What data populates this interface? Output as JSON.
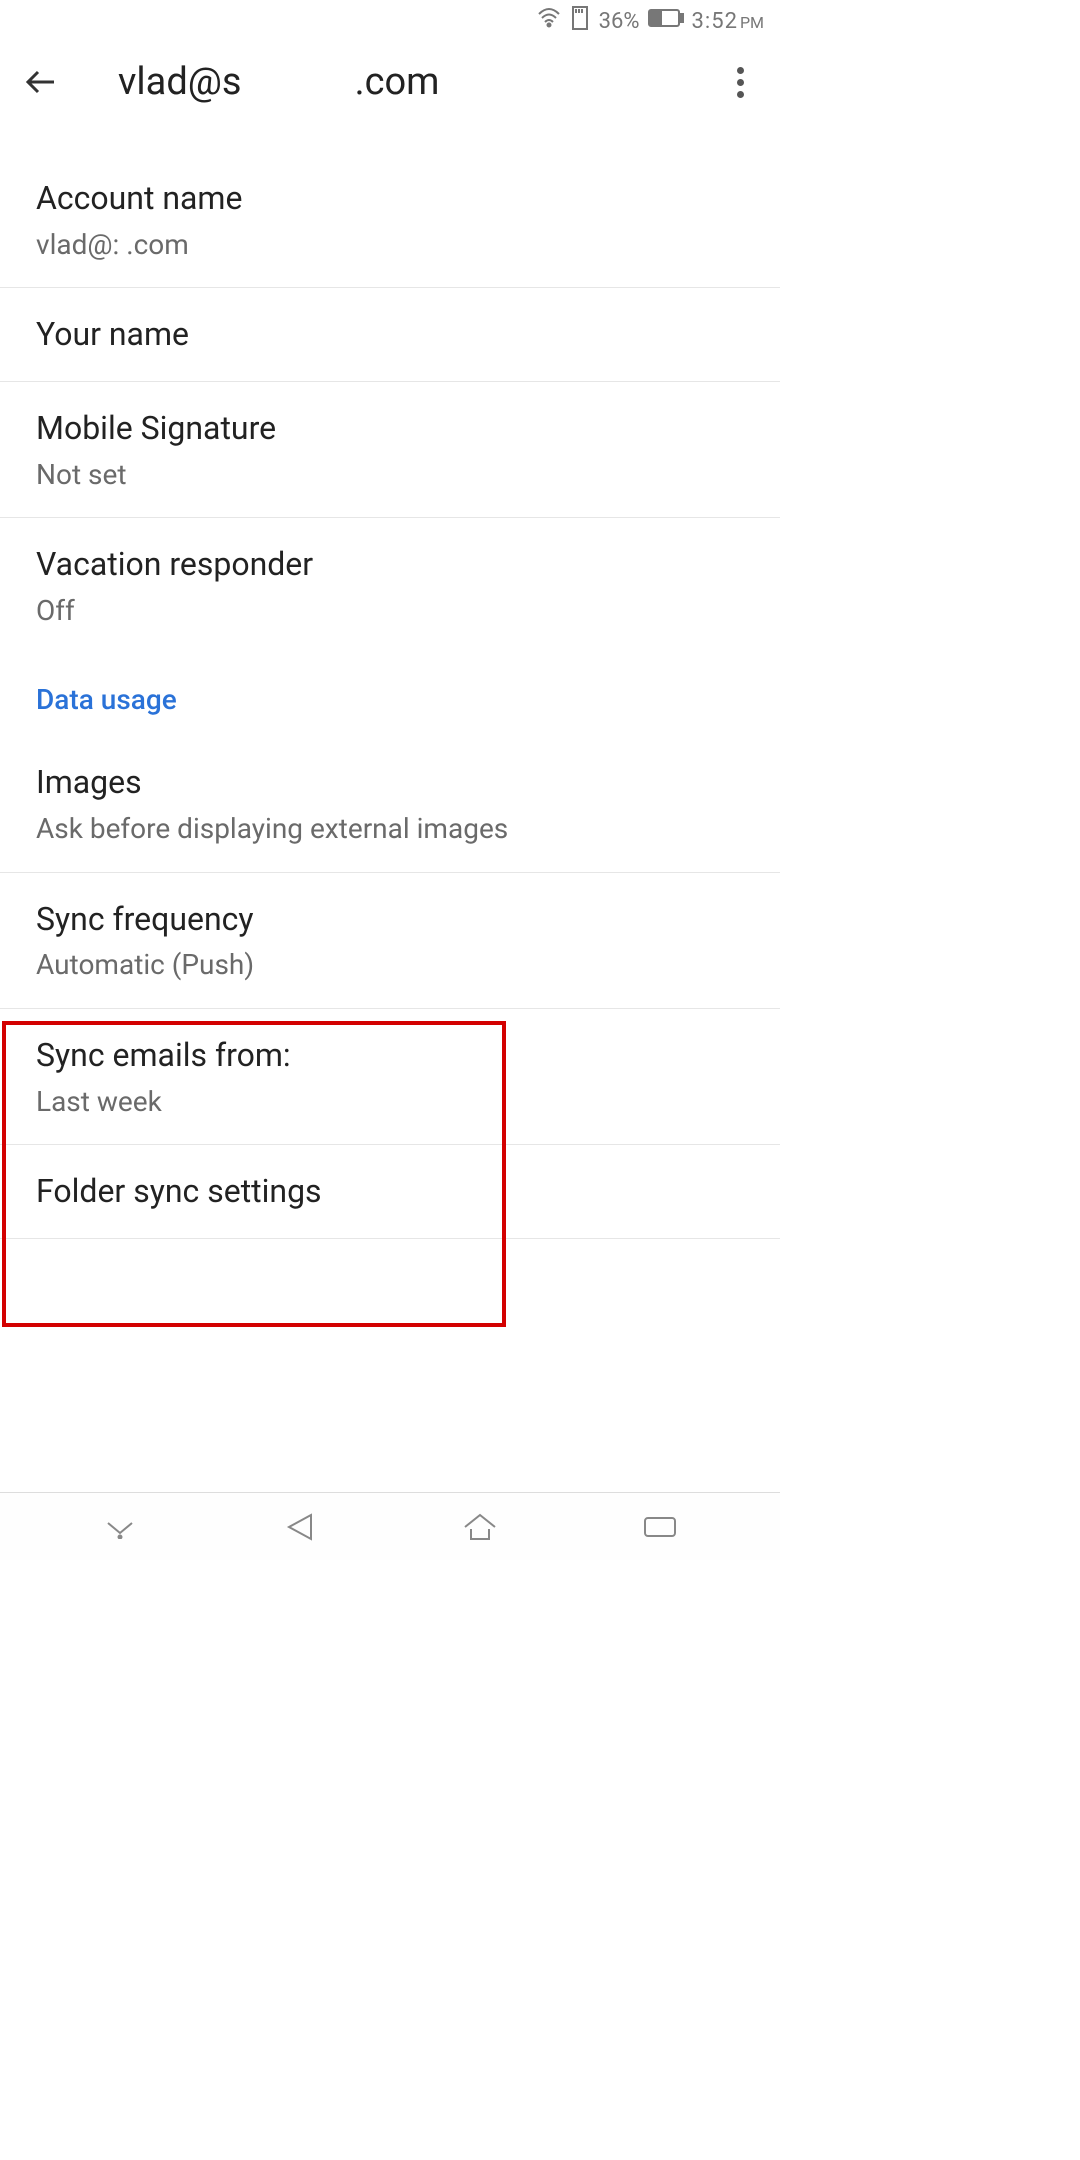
{
  "status": {
    "battery_percent": "36%",
    "time": "3:52",
    "ampm": "PM"
  },
  "header": {
    "title": "vlad@s            .com"
  },
  "settings": {
    "account_name": {
      "title": "Account name",
      "value": "vlad@:            .com"
    },
    "your_name": {
      "title": "Your name"
    },
    "mobile_signature": {
      "title": "Mobile Signature",
      "value": "Not set"
    },
    "vacation_responder": {
      "title": "Vacation responder",
      "value": "Off"
    }
  },
  "data_usage": {
    "header": "Data usage",
    "images": {
      "title": "Images",
      "value": "Ask before displaying external images"
    },
    "sync_frequency": {
      "title": "Sync frequency",
      "value": "Automatic (Push)"
    },
    "sync_emails_from": {
      "title": "Sync emails from:",
      "value": "Last week"
    },
    "folder_sync": {
      "title": "Folder sync settings"
    }
  }
}
